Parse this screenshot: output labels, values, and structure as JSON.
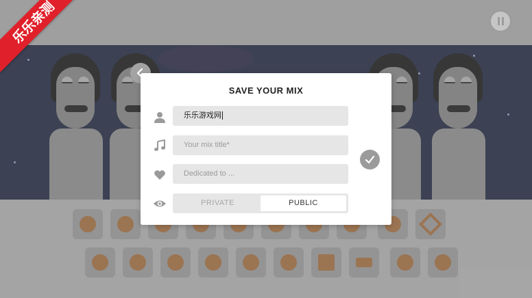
{
  "watermark": {
    "text": "乐乐亲测"
  },
  "dialog": {
    "title": "SAVE YOUR MIX",
    "author_value": "乐乐游戏网",
    "mix_title_placeholder": "Your mix title*",
    "dedicated_placeholder": "Dedicated to ...",
    "visibility": {
      "options": [
        "PRIVATE",
        "PUBLIC"
      ],
      "selected": "PUBLIC"
    }
  },
  "icons": {
    "back": "chevron-left-icon",
    "confirm": "check-icon",
    "pause": "pause-icon",
    "author": "user-icon",
    "title": "music-note-icon",
    "dedication": "heart-icon",
    "visibility": "eye-icon"
  },
  "colors": {
    "accent_orange": "#b86a24",
    "ribbon_red": "#e0202a",
    "stage_night": "#121a3a"
  }
}
